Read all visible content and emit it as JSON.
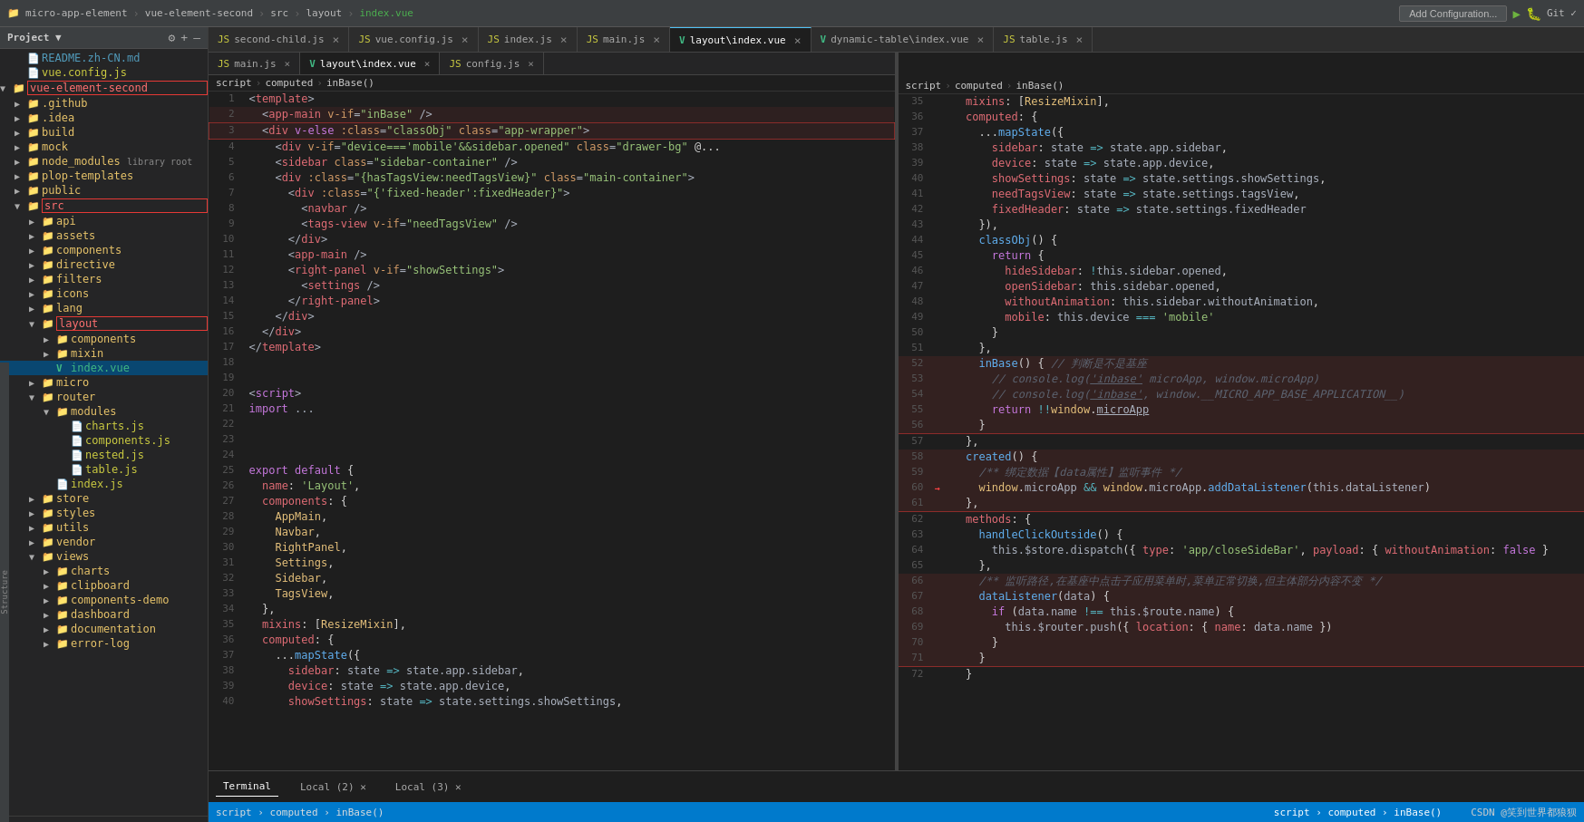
{
  "topbar": {
    "project_icon": "📁",
    "project_label": "micro-app-element",
    "sep1": "▶",
    "folder1": "vue-element-second",
    "sep2": "▶",
    "folder2": "src",
    "sep3": "▶",
    "folder3": "layout",
    "sep4": "▶",
    "file": "index.vue",
    "add_config": "Add Configuration...",
    "git_label": "Git ✓"
  },
  "sidebar": {
    "header_title": "Project ▼",
    "tree_items": [
      {
        "id": "readme",
        "depth": 1,
        "arrow": "",
        "icon": "📄",
        "label": "README.zh-CN.md",
        "type": "md",
        "expanded": false
      },
      {
        "id": "vueconfig",
        "depth": 1,
        "arrow": "",
        "icon": "⚙",
        "label": "vue.config.js",
        "type": "js",
        "expanded": false
      },
      {
        "id": "vue-element-second",
        "depth": 0,
        "arrow": "▼",
        "icon": "📁",
        "label": "vue-element-second",
        "type": "folder-red",
        "expanded": true
      },
      {
        "id": "github",
        "depth": 1,
        "arrow": "▶",
        "icon": "📁",
        "label": ".github",
        "type": "folder",
        "expanded": false
      },
      {
        "id": "idea",
        "depth": 1,
        "arrow": "▶",
        "icon": "📁",
        "label": ".idea",
        "type": "folder",
        "expanded": false
      },
      {
        "id": "build",
        "depth": 1,
        "arrow": "▶",
        "icon": "📁",
        "label": "build",
        "type": "folder",
        "expanded": false
      },
      {
        "id": "mock",
        "depth": 1,
        "arrow": "▶",
        "icon": "📁",
        "label": "mock",
        "type": "folder",
        "expanded": false
      },
      {
        "id": "node_modules",
        "depth": 1,
        "arrow": "▶",
        "icon": "📁",
        "label": "node_modules  library root",
        "type": "folder",
        "expanded": false
      },
      {
        "id": "plop",
        "depth": 1,
        "arrow": "▶",
        "icon": "📁",
        "label": "plop-templates",
        "type": "folder",
        "expanded": false
      },
      {
        "id": "public",
        "depth": 1,
        "arrow": "▶",
        "icon": "📁",
        "label": "public",
        "type": "folder",
        "expanded": false
      },
      {
        "id": "src",
        "depth": 1,
        "arrow": "▼",
        "icon": "📁",
        "label": "src",
        "type": "folder-red",
        "expanded": true
      },
      {
        "id": "api",
        "depth": 2,
        "arrow": "▶",
        "icon": "📁",
        "label": "api",
        "type": "folder",
        "expanded": false
      },
      {
        "id": "assets",
        "depth": 2,
        "arrow": "▶",
        "icon": "📁",
        "label": "assets",
        "type": "folder",
        "expanded": false
      },
      {
        "id": "components",
        "depth": 2,
        "arrow": "▶",
        "icon": "📁",
        "label": "components",
        "type": "folder",
        "expanded": false
      },
      {
        "id": "directive",
        "depth": 2,
        "arrow": "▶",
        "icon": "📁",
        "label": "directive",
        "type": "folder",
        "expanded": false
      },
      {
        "id": "filters",
        "depth": 2,
        "arrow": "▶",
        "icon": "📁",
        "label": "filters",
        "type": "folder",
        "expanded": false
      },
      {
        "id": "icons",
        "depth": 2,
        "arrow": "▶",
        "icon": "📁",
        "label": "icons",
        "type": "folder",
        "expanded": false
      },
      {
        "id": "lang",
        "depth": 2,
        "arrow": "▶",
        "icon": "📁",
        "label": "lang",
        "type": "folder",
        "expanded": false
      },
      {
        "id": "layout",
        "depth": 2,
        "arrow": "▼",
        "icon": "📁",
        "label": "layout",
        "type": "folder-red",
        "expanded": true
      },
      {
        "id": "layout-components",
        "depth": 3,
        "arrow": "▶",
        "icon": "📁",
        "label": "components",
        "type": "folder",
        "expanded": false
      },
      {
        "id": "mixin",
        "depth": 3,
        "arrow": "▶",
        "icon": "📁",
        "label": "mixin",
        "type": "folder",
        "expanded": false
      },
      {
        "id": "indexvue",
        "depth": 3,
        "arrow": "",
        "icon": "V",
        "label": "index.vue",
        "type": "vue-selected",
        "expanded": false
      },
      {
        "id": "micro",
        "depth": 2,
        "arrow": "▶",
        "icon": "📁",
        "label": "micro",
        "type": "folder",
        "expanded": false
      },
      {
        "id": "router",
        "depth": 2,
        "arrow": "▼",
        "icon": "📁",
        "label": "router",
        "type": "folder",
        "expanded": true
      },
      {
        "id": "modules",
        "depth": 3,
        "arrow": "▼",
        "icon": "📁",
        "label": "modules",
        "type": "folder",
        "expanded": true
      },
      {
        "id": "chartsjs",
        "depth": 4,
        "arrow": "",
        "icon": "📄",
        "label": "charts.js",
        "type": "js",
        "expanded": false
      },
      {
        "id": "componentsjs",
        "depth": 4,
        "arrow": "",
        "icon": "📄",
        "label": "components.js",
        "type": "js",
        "expanded": false
      },
      {
        "id": "nestedjs",
        "depth": 4,
        "arrow": "",
        "icon": "📄",
        "label": "nested.js",
        "type": "js",
        "expanded": false
      },
      {
        "id": "tablejs",
        "depth": 4,
        "arrow": "",
        "icon": "📄",
        "label": "table.js",
        "type": "js",
        "expanded": false
      },
      {
        "id": "routerindexjs",
        "depth": 3,
        "arrow": "",
        "icon": "📄",
        "label": "index.js",
        "type": "js",
        "expanded": false
      },
      {
        "id": "store",
        "depth": 2,
        "arrow": "▶",
        "icon": "📁",
        "label": "store",
        "type": "folder",
        "expanded": false
      },
      {
        "id": "styles",
        "depth": 2,
        "arrow": "▶",
        "icon": "📁",
        "label": "styles",
        "type": "folder",
        "expanded": false
      },
      {
        "id": "utils",
        "depth": 2,
        "arrow": "▶",
        "icon": "📁",
        "label": "utils",
        "type": "folder",
        "expanded": false
      },
      {
        "id": "vendor",
        "depth": 2,
        "arrow": "▶",
        "icon": "📁",
        "label": "vendor",
        "type": "folder",
        "expanded": false
      },
      {
        "id": "views",
        "depth": 2,
        "arrow": "▼",
        "icon": "📁",
        "label": "views",
        "type": "folder",
        "expanded": true
      },
      {
        "id": "charts",
        "depth": 3,
        "arrow": "▶",
        "icon": "📁",
        "label": "charts",
        "type": "folder",
        "expanded": false
      },
      {
        "id": "clipboard",
        "depth": 3,
        "arrow": "▶",
        "icon": "📁",
        "label": "clipboard",
        "type": "folder",
        "expanded": false
      },
      {
        "id": "components-demo",
        "depth": 3,
        "arrow": "▶",
        "icon": "📁",
        "label": "components-demo",
        "type": "folder",
        "expanded": false
      },
      {
        "id": "dashboard",
        "depth": 3,
        "arrow": "▶",
        "icon": "📁",
        "label": "dashboard",
        "type": "folder",
        "expanded": false
      },
      {
        "id": "documentation",
        "depth": 3,
        "arrow": "▶",
        "icon": "📁",
        "label": "documentation",
        "type": "folder",
        "expanded": false
      },
      {
        "id": "error-log",
        "depth": 3,
        "arrow": "▶",
        "icon": "📁",
        "label": "error-log",
        "type": "folder",
        "expanded": false
      }
    ]
  },
  "tabs_row1": [
    {
      "label": "second-child.js",
      "type": "js",
      "active": false
    },
    {
      "label": "vue.config.js",
      "type": "js",
      "active": false
    },
    {
      "label": "index.js",
      "type": "js",
      "active": false
    },
    {
      "label": "main.js",
      "type": "js",
      "active": false
    },
    {
      "label": "layout\\index.vue",
      "type": "vue",
      "active": true
    },
    {
      "label": "dynamic-table\\index.vue",
      "type": "vue",
      "active": false
    },
    {
      "label": "table.js",
      "type": "js",
      "active": false
    }
  ],
  "tabs_row2": [
    {
      "label": "main.js",
      "type": "js",
      "active": false
    },
    {
      "label": "layout\\index.vue",
      "type": "vue",
      "active": true
    },
    {
      "label": "config.js",
      "type": "js",
      "active": false
    }
  ],
  "left_code": [
    {
      "n": 1,
      "code": "<template>"
    },
    {
      "n": 2,
      "code": "  <app-main v-if=\"inBase\" />"
    },
    {
      "n": 3,
      "code": "  <div v-else :class=\"classObj\" class=\"app-wrapper\">"
    },
    {
      "n": 4,
      "code": "    <div v-if=\"device==='mobile'&&sidebar.opened\" class=\"drawer-bg\" @"
    },
    {
      "n": 5,
      "code": "    <sidebar class=\"sidebar-container\" />"
    },
    {
      "n": 6,
      "code": "    <div :class=\"{hasTagsView:needTagsView}\" class=\"main-container\">"
    },
    {
      "n": 7,
      "code": "      <div :class=\"{'fixed-header':fixedHeader}\">"
    },
    {
      "n": 8,
      "code": "        <navbar />"
    },
    {
      "n": 9,
      "code": "        <tags-view v-if=\"needTagsView\" />"
    },
    {
      "n": 10,
      "code": "      </div>"
    },
    {
      "n": 11,
      "code": "      <app-main />"
    },
    {
      "n": 12,
      "code": "      <right-panel v-if=\"showSettings\">"
    },
    {
      "n": 13,
      "code": "        <settings />"
    },
    {
      "n": 14,
      "code": "      </right-panel>"
    },
    {
      "n": 15,
      "code": "    </div>"
    },
    {
      "n": 16,
      "code": "  </div>"
    },
    {
      "n": 17,
      "code": "</template>"
    },
    {
      "n": 18,
      "code": ""
    },
    {
      "n": 19,
      "code": ""
    },
    {
      "n": 20,
      "code": "<script>"
    },
    {
      "n": 21,
      "code": "import ..."
    },
    {
      "n": 22,
      "code": ""
    },
    {
      "n": 23,
      "code": ""
    },
    {
      "n": 24,
      "code": ""
    },
    {
      "n": 25,
      "code": "export default {"
    },
    {
      "n": 26,
      "code": "  name: 'Layout',"
    },
    {
      "n": 27,
      "code": "  components: {"
    },
    {
      "n": 28,
      "code": "    AppMain,"
    },
    {
      "n": 29,
      "code": "    Navbar,"
    },
    {
      "n": 30,
      "code": "    RightPanel,"
    },
    {
      "n": 31,
      "code": "    Settings,"
    },
    {
      "n": 32,
      "code": "    Sidebar,"
    },
    {
      "n": 33,
      "code": "    TagsView,"
    },
    {
      "n": 34,
      "code": "  },"
    },
    {
      "n": 35,
      "code": "  mixins: [ResizeMixin],"
    },
    {
      "n": 36,
      "code": "  computed: {"
    },
    {
      "n": 37,
      "code": "    ...mapState({"
    },
    {
      "n": 38,
      "code": "      sidebar: state => state.app.sidebar,"
    },
    {
      "n": 39,
      "code": "      device: state => state.app.device,"
    },
    {
      "n": 40,
      "code": "      showSettings: state => state.settings.showSettings,"
    }
  ],
  "right_code": [
    {
      "n": 35,
      "code": "  mixins: [ResizeMixin],"
    },
    {
      "n": 36,
      "code": "  computed: {"
    },
    {
      "n": 37,
      "code": "    ...mapState({"
    },
    {
      "n": 38,
      "code": "      sidebar: state => state.app.sidebar,"
    },
    {
      "n": 39,
      "code": "      device: state => state.app.device,"
    },
    {
      "n": 40,
      "code": "      showSettings: state => state.settings.showSettings,"
    },
    {
      "n": 41,
      "code": "      needTagsView: state => state.settings.tagsView,"
    },
    {
      "n": 42,
      "code": "      fixedHeader: state => state.settings.fixedHeader"
    },
    {
      "n": 43,
      "code": "    }),"
    },
    {
      "n": 44,
      "code": "    classObj() {"
    },
    {
      "n": 45,
      "code": "      return {"
    },
    {
      "n": 46,
      "code": "        hideSidebar: !this.sidebar.opened,"
    },
    {
      "n": 47,
      "code": "        openSidebar: this.sidebar.opened,"
    },
    {
      "n": 48,
      "code": "        withoutAnimation: this.sidebar.withoutAnimation,"
    },
    {
      "n": 49,
      "code": "        mobile: this.device === 'mobile'"
    },
    {
      "n": 50,
      "code": "      }"
    },
    {
      "n": 51,
      "code": "    },"
    },
    {
      "n": 52,
      "code": "    inBase() { // 判断是不是基座",
      "highlight": "red"
    },
    {
      "n": 53,
      "code": "      // console.log('inbase' microApp, window.microApp)",
      "highlight": "red"
    },
    {
      "n": 54,
      "code": "      // console.log('inbase', window.__MICRO_APP_BASE_APPLICATION__)",
      "highlight": "red"
    },
    {
      "n": 55,
      "code": "      return !!window.microApp",
      "highlight": "red"
    },
    {
      "n": 56,
      "code": "    }",
      "highlight": "red"
    },
    {
      "n": 57,
      "code": "  },"
    },
    {
      "n": 58,
      "code": "  created() {",
      "highlight": "red2"
    },
    {
      "n": 59,
      "code": "    /** 绑定数据【data属性】监听事件 */",
      "highlight": "red2"
    },
    {
      "n": 60,
      "code": "    window.microApp && window.microApp.addDataListener(this.dataListener)",
      "highlight": "red2-arrow"
    },
    {
      "n": 61,
      "code": "  },",
      "highlight": "red2"
    },
    {
      "n": 62,
      "code": "  methods: {"
    },
    {
      "n": 63,
      "code": "    handleClickOutside() {"
    },
    {
      "n": 64,
      "code": "      this.$store.dispatch({ type: 'app/closeSideBar', payload: { withoutAnimation: false }"
    },
    {
      "n": 65,
      "code": "    },"
    },
    {
      "n": 66,
      "code": "    /** 监听路径,在基座中点击子应用菜单时,菜单正常切换,但主体部分内容不变 */",
      "highlight": "red3"
    },
    {
      "n": 67,
      "code": "    dataListener(data) {",
      "highlight": "red3"
    },
    {
      "n": 68,
      "code": "      if (data.name !== this.$route.name) {",
      "highlight": "red3"
    },
    {
      "n": 69,
      "code": "        this.$router.push({ location: { name: data.name })",
      "highlight": "red3"
    },
    {
      "n": 70,
      "code": "      }",
      "highlight": "red3"
    },
    {
      "n": 71,
      "code": "    }",
      "highlight": "red3"
    },
    {
      "n": 72,
      "code": "  }"
    }
  ],
  "breadcrumbs_left": {
    "items": [
      "script",
      "computed",
      "inBase()"
    ]
  },
  "breadcrumbs_right": {
    "items": [
      "script",
      "computed",
      "inBase()"
    ]
  },
  "status_bar": {
    "left": "Terminal: Local (2) ✕   Local (3) ✕",
    "right": "CSDN @笑到世界都狼狈"
  },
  "bottom_tabs": [
    "Terminal",
    "Local (2) ✕",
    "Local (3) ✕"
  ]
}
